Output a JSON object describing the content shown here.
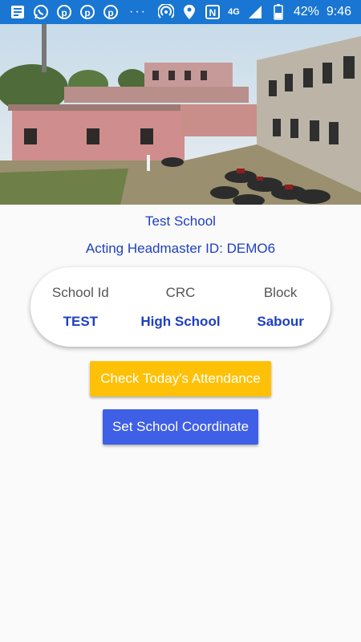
{
  "status_bar": {
    "network_type": "4G",
    "battery_percent": "42%",
    "time": "9:46",
    "overflow_dots": "···",
    "left_icons": [
      "news-icon",
      "whatsapp-icon",
      "pinterest-icon",
      "pinterest-icon",
      "pinterest-icon"
    ],
    "right_icons": [
      "hotspot-icon",
      "location-icon",
      "nfc-icon",
      "signal-icon",
      "battery-icon"
    ]
  },
  "hero_image": {
    "description": "school-building-photo"
  },
  "school": {
    "name": "Test School",
    "headmaster_line": "Acting Headmaster ID: DEMO6"
  },
  "info_card": {
    "columns": [
      {
        "label": "School Id",
        "value": "TEST"
      },
      {
        "label": "CRC",
        "value": "High School"
      },
      {
        "label": "Block",
        "value": "Sabour"
      }
    ]
  },
  "actions": {
    "attendance_label": "Check Today's Attendance",
    "coordinate_label": "Set School Coordinate"
  },
  "colors": {
    "status_bar": "#1976d2",
    "accent_text": "#1e3fc2",
    "attendance_button": "#ffc107",
    "coordinate_button": "#3f5fe6",
    "background": "#fafafa"
  }
}
